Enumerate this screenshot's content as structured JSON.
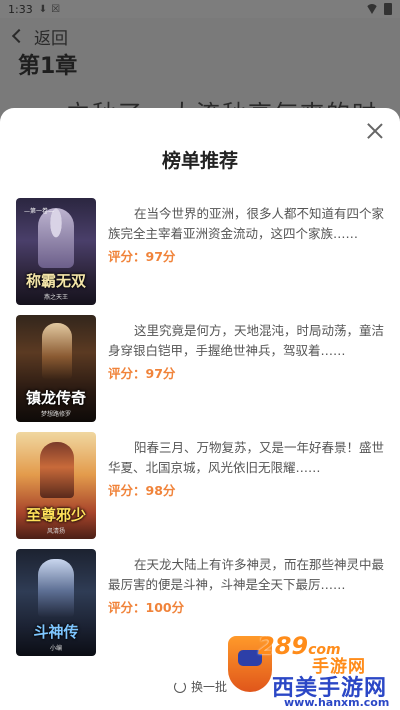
{
  "status_bar": {
    "time": "1:33",
    "icons": [
      "download-icon",
      "notification-x-icon",
      "wifi-icon",
      "battery-icon"
    ]
  },
  "reader": {
    "back_label": "返回",
    "chapter_title": "第1章",
    "text_preview": "立秋了，太流秋高气爽的时"
  },
  "modal": {
    "title": "榜单推荐",
    "refresh_label": "换一批",
    "books": [
      {
        "cover_title": "称霸无双",
        "cover_badge": "—第一卷—",
        "cover_author": "燕之天王",
        "description": "在当今世界的亚洲，很多人都不知道有四个家族完全主宰着亚洲资金流动，这四个家族……",
        "score": "评分：97分"
      },
      {
        "cover_title": "镇龙传奇",
        "cover_badge": "",
        "cover_author": "梦想路修罗",
        "description": "这里究竟是何方，天地混沌，时局动荡，童洁身穿银白铠甲，手握绝世神兵，驾驭着……",
        "score": "评分：97分"
      },
      {
        "cover_title": "至尊邪少",
        "cover_badge": "",
        "cover_author": "风清扬",
        "description": "阳春三月、万物复苏，又是一年好春景！盛世华夏、北国京城，风光依旧无限耀……",
        "score": "评分：98分"
      },
      {
        "cover_title": "斗神传",
        "cover_badge": "",
        "cover_author": "小编",
        "description": "在天龙大陆上有许多神灵，而在那些神灵中最最厉害的便是斗神，斗神是全天下最厉……",
        "score": "评分：100分"
      }
    ]
  },
  "watermark": {
    "number": "289",
    "suffix": "com",
    "sub": "手游网",
    "brand": "西美手游网",
    "url": "www.hanxm.com"
  },
  "colors": {
    "score": "#f0833a",
    "overlay": "#7a7a7a",
    "brand_blue": "#2b47c6",
    "brand_orange": "#ff8c1a"
  }
}
